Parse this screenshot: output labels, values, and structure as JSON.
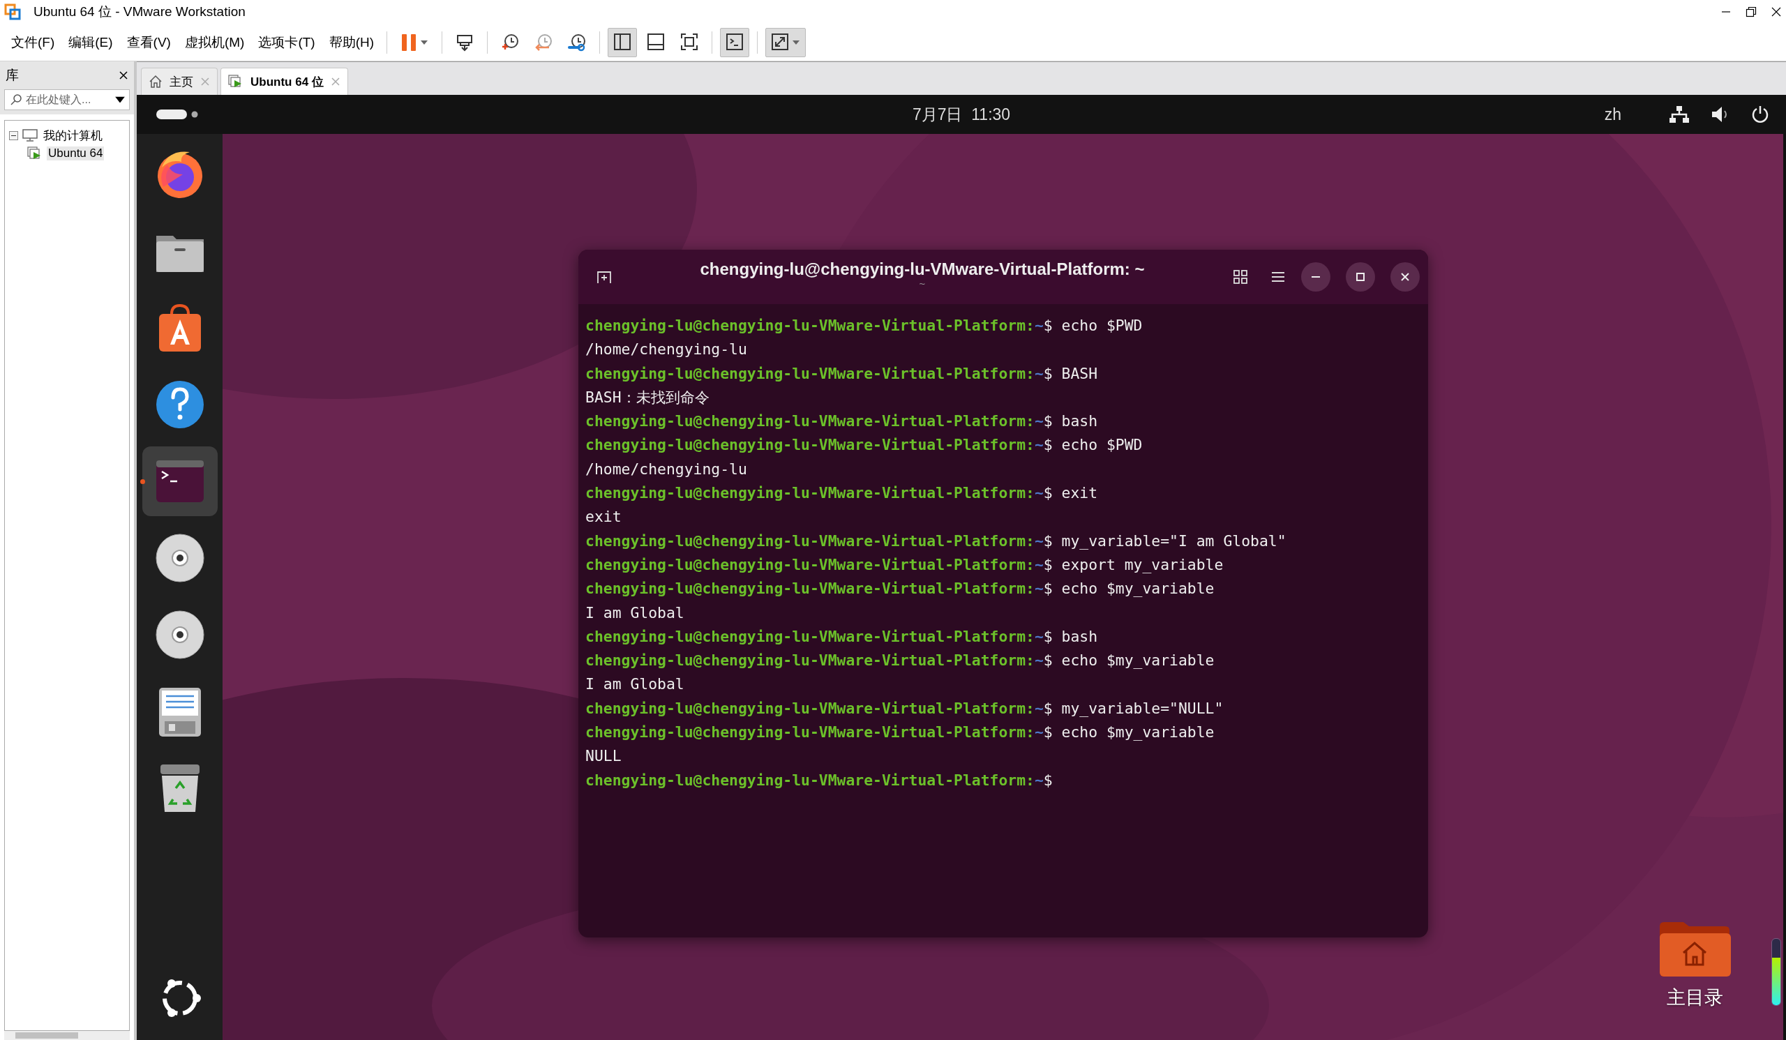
{
  "window": {
    "title": "Ubuntu 64 位 - VMware Workstation"
  },
  "menu": [
    "文件(F)",
    "编辑(E)",
    "查看(V)",
    "虚拟机(M)",
    "选项卡(T)",
    "帮助(H)"
  ],
  "toolbar": [
    [
      {
        "kind": "pause",
        "pressed": false
      }
    ],
    [
      {
        "kind": "send_keys",
        "pressed": false
      }
    ],
    [
      {
        "kind": "snapshot",
        "pressed": false
      },
      {
        "kind": "revert",
        "pressed": false
      },
      {
        "kind": "snapshot_manager",
        "pressed": false
      }
    ],
    [
      {
        "kind": "library_view",
        "pressed": true
      },
      {
        "kind": "thumbnail_view",
        "pressed": false
      },
      {
        "kind": "fullscreen",
        "pressed": false
      }
    ],
    [
      {
        "kind": "console_view",
        "pressed": true
      }
    ],
    [
      {
        "kind": "stretch",
        "pressed": true
      }
    ]
  ],
  "library": {
    "title": "库",
    "search": {
      "placeholder": "在此处键入..."
    },
    "tree": [
      {
        "label": "我的计算机",
        "kind": "computer",
        "expanded": true,
        "selected": false,
        "children": [
          {
            "label": "Ubuntu 64",
            "kind": "vm",
            "selected": true
          }
        ]
      }
    ]
  },
  "tabs": [
    {
      "label": "主页",
      "kind": "home",
      "selected": false
    },
    {
      "label": "Ubuntu 64 位",
      "kind": "vm",
      "selected": true
    }
  ],
  "topbar": {
    "clock": "7月7日  11:30",
    "input_method": "zh"
  },
  "dock": [
    {
      "kind": "firefox",
      "active": false
    },
    {
      "kind": "files",
      "active": false
    },
    {
      "kind": "software",
      "active": false
    },
    {
      "kind": "help",
      "active": false
    },
    {
      "kind": "terminal",
      "active": true
    },
    {
      "kind": "disc",
      "active": false
    },
    {
      "kind": "disc",
      "active": false
    },
    {
      "kind": "document",
      "active": false
    },
    {
      "kind": "trash",
      "active": false
    },
    {
      "kind": "apps",
      "active": false
    }
  ],
  "terminal": {
    "title": "chengying-lu@chengying-lu-VMware-Virtual-Platform: ~",
    "subtitle": "~",
    "lines": [
      {
        "kind": "prompt",
        "user": "chengying-lu@chengying-lu-VMware-Virtual-Platform:",
        "path": "~",
        "command": "$ echo $PWD"
      },
      {
        "kind": "output",
        "text": "/home/chengying-lu"
      },
      {
        "kind": "prompt",
        "user": "chengying-lu@chengying-lu-VMware-Virtual-Platform:",
        "path": "~",
        "command": "$ BASH"
      },
      {
        "kind": "output",
        "text": "BASH：未找到命令"
      },
      {
        "kind": "prompt",
        "user": "chengying-lu@chengying-lu-VMware-Virtual-Platform:",
        "path": "~",
        "command": "$ bash"
      },
      {
        "kind": "prompt",
        "user": "chengying-lu@chengying-lu-VMware-Virtual-Platform:",
        "path": "~",
        "command": "$ echo $PWD"
      },
      {
        "kind": "output",
        "text": "/home/chengying-lu"
      },
      {
        "kind": "prompt",
        "user": "chengying-lu@chengying-lu-VMware-Virtual-Platform:",
        "path": "~",
        "command": "$ exit"
      },
      {
        "kind": "output",
        "text": "exit"
      },
      {
        "kind": "prompt",
        "user": "chengying-lu@chengying-lu-VMware-Virtual-Platform:",
        "path": "~",
        "command": "$ my_variable=\"I am Global\""
      },
      {
        "kind": "prompt",
        "user": "chengying-lu@chengying-lu-VMware-Virtual-Platform:",
        "path": "~",
        "command": "$ export my_variable"
      },
      {
        "kind": "prompt",
        "user": "chengying-lu@chengying-lu-VMware-Virtual-Platform:",
        "path": "~",
        "command": "$ echo $my_variable"
      },
      {
        "kind": "output",
        "text": "I am Global"
      },
      {
        "kind": "prompt",
        "user": "chengying-lu@chengying-lu-VMware-Virtual-Platform:",
        "path": "~",
        "command": "$ bash"
      },
      {
        "kind": "prompt",
        "user": "chengying-lu@chengying-lu-VMware-Virtual-Platform:",
        "path": "~",
        "command": "$ echo $my_variable"
      },
      {
        "kind": "output",
        "text": "I am Global"
      },
      {
        "kind": "prompt",
        "user": "chengying-lu@chengying-lu-VMware-Virtual-Platform:",
        "path": "~",
        "command": "$ my_variable=\"NULL\""
      },
      {
        "kind": "prompt",
        "user": "chengying-lu@chengying-lu-VMware-Virtual-Platform:",
        "path": "~",
        "command": "$ echo $my_variable"
      },
      {
        "kind": "output",
        "text": "NULL"
      },
      {
        "kind": "prompt",
        "user": "chengying-lu@chengying-lu-VMware-Virtual-Platform:",
        "path": "~",
        "command": "$"
      }
    ]
  },
  "desktop": {
    "home_folder": {
      "label": "主目录"
    },
    "volume_meter": {
      "level": 0.72
    }
  }
}
